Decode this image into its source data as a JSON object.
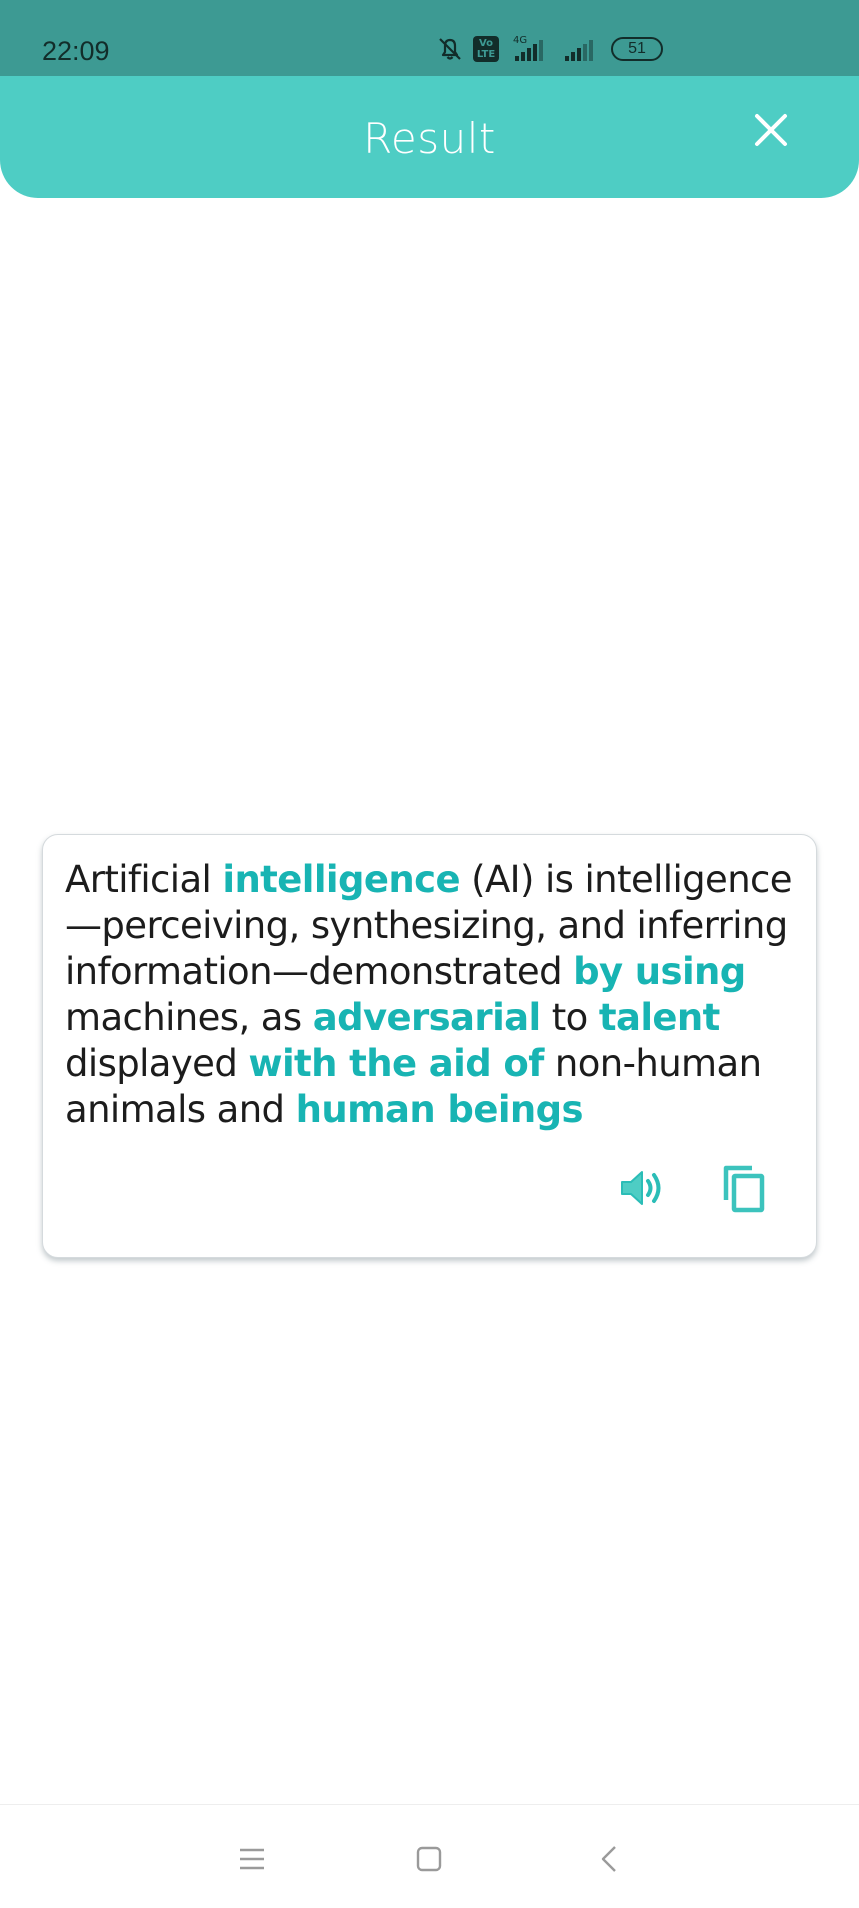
{
  "status_bar": {
    "time": "22:09",
    "battery": "51",
    "network": "4G",
    "volte": "Vo LTE",
    "icons": [
      "bell-muted-icon",
      "volte-icon",
      "signal-4g-icon",
      "signal-icon",
      "battery-icon"
    ]
  },
  "header": {
    "title": "Result",
    "close_icon": "close-icon",
    "background": "#4ecdc4"
  },
  "result": {
    "segments": [
      {
        "text": "Artificial ",
        "highlight": false
      },
      {
        "text": "intelligence",
        "highlight": true
      },
      {
        "text": " (AI) is intelligence—perceiving, synthesizing, and inferring information—demonstrated ",
        "highlight": false
      },
      {
        "text": "by using",
        "highlight": true
      },
      {
        "text": " machines, as ",
        "highlight": false
      },
      {
        "text": "adversarial",
        "highlight": true
      },
      {
        "text": " to ",
        "highlight": false
      },
      {
        "text": "talent",
        "highlight": true
      },
      {
        "text": " displayed ",
        "highlight": false
      },
      {
        "text": "with the aid of",
        "highlight": true
      },
      {
        "text": " non-human animals and ",
        "highlight": false
      },
      {
        "text": "human beings",
        "highlight": true
      }
    ],
    "highlight_color": "#18b4b3",
    "actions": [
      "speaker-icon",
      "copy-icon"
    ]
  },
  "nav_bar": {
    "icons": [
      "menu-icon",
      "home-icon",
      "back-icon"
    ]
  }
}
